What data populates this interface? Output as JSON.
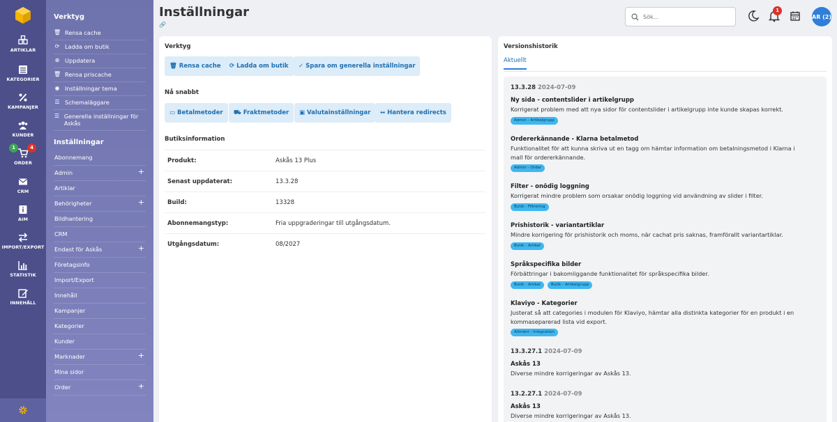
{
  "rail": {
    "items": [
      {
        "label": "ARTIKLAR",
        "icon": "boxes-icon"
      },
      {
        "label": "KATEGORIER",
        "icon": "list-icon"
      },
      {
        "label": "KAMPANJER",
        "icon": "percent-icon"
      },
      {
        "label": "KUNDER",
        "icon": "users-icon"
      },
      {
        "label": "ORDER",
        "icon": "cart-icon"
      },
      {
        "label": "CRM",
        "icon": "mail-icon"
      },
      {
        "label": "AIM",
        "icon": "info-icon"
      },
      {
        "label": "IMPORT/EXPORT",
        "icon": "swap-icon"
      },
      {
        "label": "STATISTIK",
        "icon": "chart-icon"
      },
      {
        "label": "INNEHÅLL",
        "icon": "edit-icon"
      }
    ],
    "order_badge_green": "1",
    "order_badge_red": "4"
  },
  "panel": {
    "tools_title": "Verktyg",
    "tools": [
      {
        "label": "Rensa cache",
        "icon": "🗑"
      },
      {
        "label": "Ladda om butik",
        "icon": "⟳"
      },
      {
        "label": "Uppdatera",
        "icon": "⊕"
      },
      {
        "label": "Rensa priscache",
        "icon": "🗑"
      },
      {
        "label": "Inställningar tema",
        "icon": "◉"
      },
      {
        "label": "Schemaläggare",
        "icon": "☰"
      },
      {
        "label": "Generella inställningar för Askås",
        "icon": "☰"
      }
    ],
    "settings_title": "Inställningar",
    "settings": [
      {
        "label": "Abonnemang",
        "plus": ""
      },
      {
        "label": "Admin",
        "plus": "+"
      },
      {
        "label": "Artiklar",
        "plus": ""
      },
      {
        "label": "Behörigheter",
        "plus": "+"
      },
      {
        "label": "Bildhantering",
        "plus": ""
      },
      {
        "label": "CRM",
        "plus": ""
      },
      {
        "label": "Endast för Askås",
        "plus": "+"
      },
      {
        "label": "Företagsinfo",
        "plus": ""
      },
      {
        "label": "Import/Export",
        "plus": ""
      },
      {
        "label": "Innehåll",
        "plus": ""
      },
      {
        "label": "Kampanjer",
        "plus": ""
      },
      {
        "label": "Kategorier",
        "plus": ""
      },
      {
        "label": "Kunder",
        "plus": ""
      },
      {
        "label": "Marknader",
        "plus": "+"
      },
      {
        "label": "Mina sidor",
        "plus": ""
      },
      {
        "label": "Order",
        "plus": "+"
      }
    ]
  },
  "header": {
    "title": "Inställningar",
    "search_placeholder": "Sök...",
    "notification_count": "1",
    "avatar": "AR (2)"
  },
  "left": {
    "tools_title": "Verktyg",
    "tool_buttons": [
      {
        "label": "Rensa cache",
        "icon": "🗑"
      },
      {
        "label": "Ladda om butik",
        "icon": "⟳"
      },
      {
        "label": "Spara om generella inställningar",
        "icon": "✓"
      }
    ],
    "quick_title": "Nå snabbt",
    "quick_buttons": [
      {
        "label": "Betalmetoder",
        "icon": "▭"
      },
      {
        "label": "Fraktmetoder",
        "icon": "⛟"
      },
      {
        "label": "Valutainställningar",
        "icon": "▣"
      },
      {
        "label": "Hantera redirects",
        "icon": "↔"
      }
    ],
    "info_title": "Butiksinformation",
    "info": [
      {
        "k": "Produkt:",
        "v": "Askås 13 Plus"
      },
      {
        "k": "Senast uppdaterat:",
        "v": "13.3.28"
      },
      {
        "k": "Build:",
        "v": "13328"
      },
      {
        "k": "Abonnemangstyp:",
        "v": "Fria uppgraderingar till utgångsdatum."
      },
      {
        "k": "Utgångsdatum:",
        "v": "08/2027"
      }
    ]
  },
  "right": {
    "title": "Versionshistorik",
    "tab": "Aktuellt",
    "v1_version": "13.3.28",
    "v1_date": "2024-07-09",
    "entries": [
      {
        "title": "Ny sida - contentslider i artikelgrupp",
        "desc": "Korrigerat problem med att nya sidor för contentslider i artikelgrupp inte kunde skapas korrekt.",
        "tags": [
          "Admin - Artikelgrupp"
        ]
      },
      {
        "title": "Ordererkännande - Klarna betalmetod",
        "desc": "Funktionalitet för att kunna skriva ut en tagg om hämtar information om betalningsmetod i Klarna i mall för ordererkännande.",
        "tags": [
          "Admin - Order"
        ]
      },
      {
        "title": "Filter - onödig loggning",
        "desc": "Korrigerat mindre problem som orsakar onödig loggning vid användning av slider i filter.",
        "tags": [
          "Butik - Filtrering"
        ]
      },
      {
        "title": "Prishistorik - variantartiklar",
        "desc": "Mindre korrigering för prishistorik och moms, när cachat pris saknas, framförallt variantartiklar.",
        "tags": [
          "Butik - Artikel"
        ]
      },
      {
        "title": "Språkspecifika bilder",
        "desc": "Förbättringar i bakomliggande funktionalitet för språkspecifika bilder.",
        "tags": [
          "Butik - Artikel",
          "Butik - Artikelgrupp"
        ]
      },
      {
        "title": "Klaviyo - Kategorier",
        "desc": "Justerat så att categories i modulen för Klaviyo, hämtar alla distinkta kategorier för en produkt i en kommaseparerad lista vid export.",
        "tags": [
          "Allmänt - Integration"
        ]
      }
    ],
    "v2_version": "13.3.27.1",
    "v2_date": "2024-07-09",
    "v2_title": "Askås 13",
    "v2_desc": "Diverse mindre korrigeringar av Askås 13.",
    "v3_version": "13.2.27.1",
    "v3_date": "2024-07-09",
    "v3_title": "Askås 13",
    "v3_desc": "Diverse mindre korrigeringar av Askås 13."
  }
}
